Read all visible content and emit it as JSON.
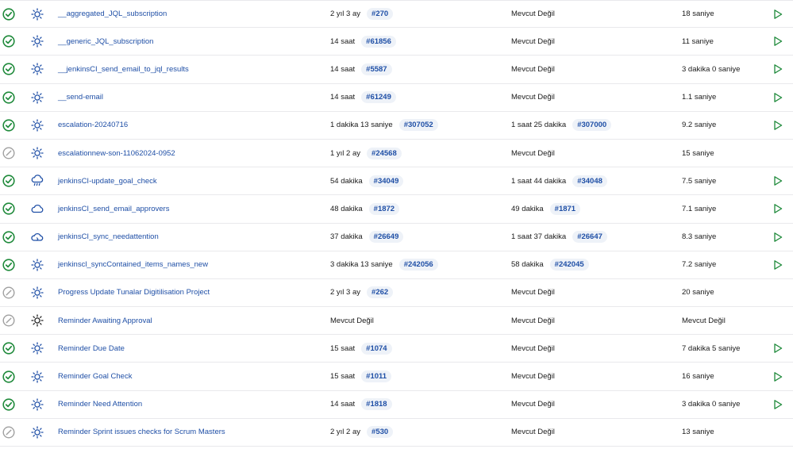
{
  "colors": {
    "success": "#1f8a3b",
    "disabled": "#a0a0a0",
    "link": "#1f4fa6",
    "run": "#1f8a3b"
  },
  "jobs": [
    {
      "status": "success",
      "weather": "sunny",
      "name": "__aggregated_JQL_subscription",
      "last_success": "2 yıl 3 ay",
      "last_success_build": "#270",
      "last_failure": "Mevcut Değil",
      "last_failure_build": "",
      "duration": "18 saniye",
      "runnable": true
    },
    {
      "status": "success",
      "weather": "sunny",
      "name": "__generic_JQL_subscription",
      "last_success": "14 saat",
      "last_success_build": "#61856",
      "last_failure": "Mevcut Değil",
      "last_failure_build": "",
      "duration": "11 saniye",
      "runnable": true
    },
    {
      "status": "success",
      "weather": "sunny",
      "name": "__jenkinsCI_send_email_to_jql_results",
      "last_success": "14 saat",
      "last_success_build": "#5587",
      "last_failure": "Mevcut Değil",
      "last_failure_build": "",
      "duration": "3 dakika 0 saniye",
      "runnable": true
    },
    {
      "status": "success",
      "weather": "sunny",
      "name": "__send-email",
      "last_success": "14 saat",
      "last_success_build": "#61249",
      "last_failure": "Mevcut Değil",
      "last_failure_build": "",
      "duration": "1.1 saniye",
      "runnable": true
    },
    {
      "status": "success",
      "weather": "sunny",
      "name": "escalation-20240716",
      "last_success": "1 dakika 13 saniye",
      "last_success_build": "#307052",
      "last_failure": "1 saat 25 dakika",
      "last_failure_build": "#307000",
      "duration": "9.2 saniye",
      "runnable": true
    },
    {
      "status": "disabled",
      "weather": "sunny",
      "name": "escalationnew-son-11062024-0952",
      "last_success": "1 yıl 2 ay",
      "last_success_build": "#24568",
      "last_failure": "Mevcut Değil",
      "last_failure_build": "",
      "duration": "15 saniye",
      "runnable": false
    },
    {
      "status": "success",
      "weather": "rain",
      "name": "jenkinsCI-update_goal_check",
      "last_success": "54 dakika",
      "last_success_build": "#34049",
      "last_failure": "1 saat 44 dakika",
      "last_failure_build": "#34048",
      "duration": "7.5 saniye",
      "runnable": true
    },
    {
      "status": "success",
      "weather": "cloud",
      "name": "jenkinsCI_send_email_approvers",
      "last_success": "48 dakika",
      "last_success_build": "#1872",
      "last_failure": "49 dakika",
      "last_failure_build": "#1871",
      "duration": "7.1 saniye",
      "runnable": true
    },
    {
      "status": "success",
      "weather": "cloud-sun",
      "name": "jenkinsCI_sync_needattention",
      "last_success": "37 dakika",
      "last_success_build": "#26649",
      "last_failure": "1 saat 37 dakika",
      "last_failure_build": "#26647",
      "duration": "8.3 saniye",
      "runnable": true
    },
    {
      "status": "success",
      "weather": "sunny",
      "name": "jenkinscl_syncContained_items_names_new",
      "last_success": "3 dakika 13 saniye",
      "last_success_build": "#242056",
      "last_failure": "58 dakika",
      "last_failure_build": "#242045",
      "duration": "7.2 saniye",
      "runnable": true
    },
    {
      "status": "disabled",
      "weather": "sunny",
      "name": "Progress Update Tunalar Digitilisation Project",
      "last_success": "2 yıl 3 ay",
      "last_success_build": "#262",
      "last_failure": "Mevcut Değil",
      "last_failure_build": "",
      "duration": "20 saniye",
      "runnable": false
    },
    {
      "status": "disabled",
      "weather": "sunny-dark",
      "name": "Reminder Awaiting Approval",
      "last_success": "Mevcut Değil",
      "last_success_build": "",
      "last_failure": "Mevcut Değil",
      "last_failure_build": "",
      "duration": "Mevcut Değil",
      "runnable": false
    },
    {
      "status": "success",
      "weather": "sunny",
      "name": "Reminder Due Date",
      "last_success": "15 saat",
      "last_success_build": "#1074",
      "last_failure": "Mevcut Değil",
      "last_failure_build": "",
      "duration": "7 dakika 5 saniye",
      "runnable": true
    },
    {
      "status": "success",
      "weather": "sunny",
      "name": "Reminder Goal Check",
      "last_success": "15 saat",
      "last_success_build": "#1011",
      "last_failure": "Mevcut Değil",
      "last_failure_build": "",
      "duration": "16 saniye",
      "runnable": true
    },
    {
      "status": "success",
      "weather": "sunny",
      "name": "Reminder Need Attention",
      "last_success": "14 saat",
      "last_success_build": "#1818",
      "last_failure": "Mevcut Değil",
      "last_failure_build": "",
      "duration": "3 dakika 0 saniye",
      "runnable": true
    },
    {
      "status": "disabled",
      "weather": "sunny",
      "name": "Reminder Sprint issues checks for Scrum Masters",
      "last_success": "2 yıl 2 ay",
      "last_success_build": "#530",
      "last_failure": "Mevcut Değil",
      "last_failure_build": "",
      "duration": "13 saniye",
      "runnable": false
    }
  ]
}
